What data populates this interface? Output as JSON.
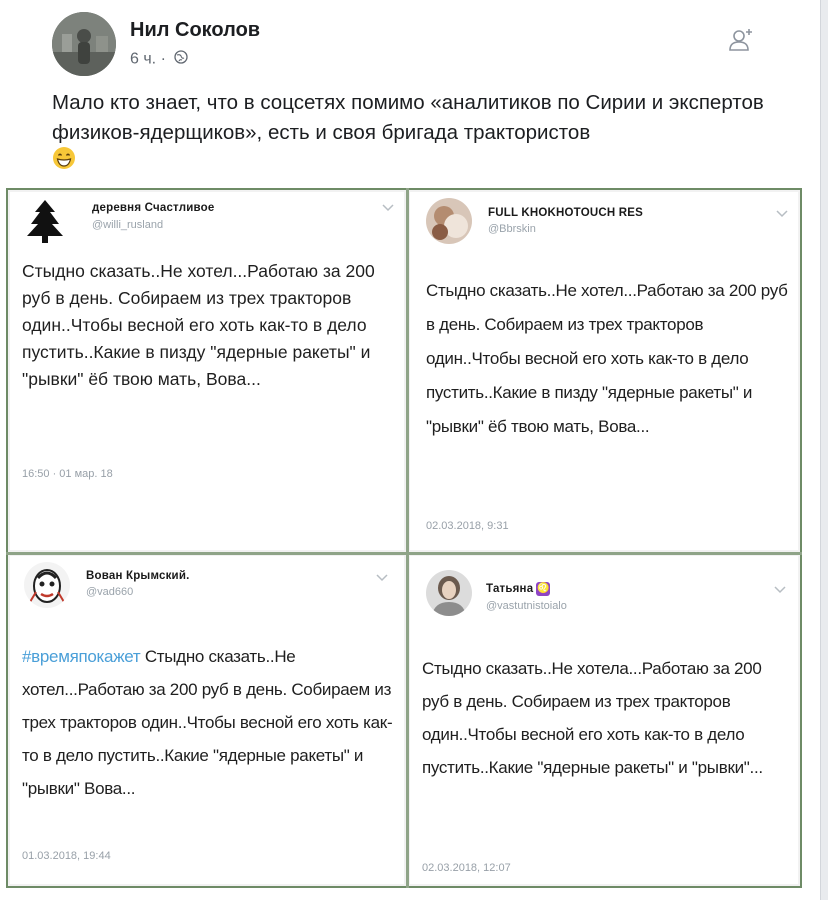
{
  "post": {
    "author": "Нил Соколов",
    "time": "6 ч.",
    "separator": "·",
    "text": "Мало кто знает, что в соцсетях помимо «аналитиков по Сирии и экспертов физиков-ядерщиков», есть и своя бригада трактористов",
    "emoji": "grinning-face-emoji"
  },
  "tweets": [
    {
      "name": "деревня Счастливое",
      "handle": "@willi_rusland",
      "text": "Стыдно сказать..Не хотел...Работаю за 200 руб в день. Собираем из трех тракторов один..Чтобы весной его хоть как-то в дело пустить..Какие в пизду \"ядерные ракеты\" и \"рывки\" ёб твою мать, Вова...",
      "time": "16:50 · 01 мар. 18",
      "avatar": "tree-icon"
    },
    {
      "name": "FULL KHOKHOTOUCH RES",
      "handle": "@Bbrskin",
      "text": "Стыдно сказать..Не хотел...Работаю за 200 руб в день. Собираем из трех тракторов один..Чтобы весной его хоть как-то в дело пустить..Какие в пизду \"ядерные ракеты\" и \"рывки\" ёб твою мать, Вова...",
      "time": "02.03.2018, 9:31",
      "avatar": "photo-avatar"
    },
    {
      "name": "Вован Крымский.",
      "handle": "@vad660",
      "hashtag": "#времяпокажет",
      "text": "Стыдно сказать..Не хотел...Работаю за 200 руб в день. Собираем из трех тракторов один..Чтобы весной его хоть как-то в дело пустить..Какие \"ядерные ракеты\" и \"рывки\" Вова...",
      "time": "01.03.2018, 19:44",
      "avatar": "face-drawing-avatar"
    },
    {
      "name": "Татьяна",
      "handle": "@vastutnistoialo",
      "text": "Стыдно сказать..Не хотела...Работаю за 200 руб в день. Собираем из трех тракторов один..Чтобы весной его хоть как-то в дело пустить..Какие \"ядерные ракеты\" и \"рывки\"...",
      "time": "02.03.2018, 12:07",
      "avatar": "woman-photo-avatar",
      "badge": "leo-zodiac-icon"
    }
  ],
  "colors": {
    "hashtag": "#4a9fd8",
    "frame": "#6e8b66",
    "text": "#1c1e21",
    "muted": "#606770"
  }
}
